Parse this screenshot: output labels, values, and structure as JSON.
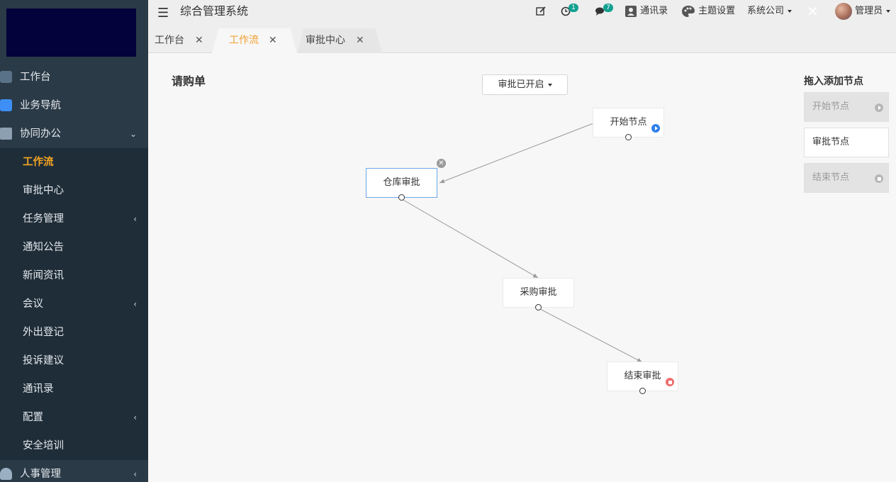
{
  "header": {
    "title": "综合管理系统",
    "notify_count": "1",
    "message_count": "7",
    "contacts_label": "通讯录",
    "theme_label": "主题设置",
    "company_label": "系统公司",
    "user_label": "管理员"
  },
  "sidebar": {
    "items": [
      {
        "label": "工作台",
        "icon": "desk-icon"
      },
      {
        "label": "业务导航",
        "icon": "business-icon"
      },
      {
        "label": "协同办公",
        "icon": "briefcase-icon",
        "expanded": true,
        "children": [
          {
            "label": "工作流",
            "active": true
          },
          {
            "label": "审批中心"
          },
          {
            "label": "任务管理",
            "has_children": true
          },
          {
            "label": "通知公告"
          },
          {
            "label": "新闻资讯"
          },
          {
            "label": "会议",
            "has_children": true
          },
          {
            "label": "外出登记"
          },
          {
            "label": "投诉建议"
          },
          {
            "label": "通讯录"
          },
          {
            "label": "配置",
            "has_children": true
          },
          {
            "label": "安全培训"
          }
        ]
      },
      {
        "label": "人事管理",
        "icon": "person-icon",
        "has_children": true
      }
    ]
  },
  "tabs": [
    {
      "label": "工作台"
    },
    {
      "label": "工作流",
      "active": true
    },
    {
      "label": "审批中心"
    }
  ],
  "main": {
    "form_title": "请购单",
    "status_dropdown": "审批已开启",
    "nodes": [
      {
        "label": "开始节点",
        "type": "start"
      },
      {
        "label": "仓库审批",
        "type": "approval",
        "selected": true
      },
      {
        "label": "采购审批",
        "type": "approval"
      },
      {
        "label": "结束审批",
        "type": "end"
      }
    ],
    "palette": {
      "title": "拖入添加节点",
      "items": [
        {
          "label": "开始节点",
          "enabled": false
        },
        {
          "label": "审批节点",
          "enabled": true
        },
        {
          "label": "结束节点",
          "enabled": false
        }
      ]
    }
  },
  "colors": {
    "sidebar_bg": "#2b3a47",
    "active_accent": "#f5a623",
    "badge": "#12a190",
    "selected_border": "#6aa7e8",
    "start_icon": "#2f80ed",
    "end_icon": "#ef6d6d"
  }
}
